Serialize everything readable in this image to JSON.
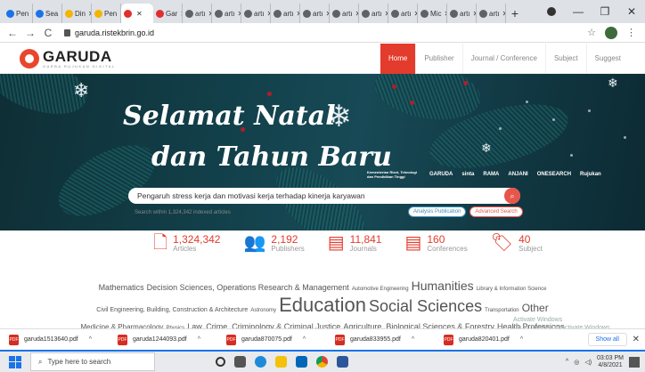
{
  "browser": {
    "tabs": [
      {
        "label": "Pen",
        "icon": "blue"
      },
      {
        "label": "Sea",
        "icon": "blue"
      },
      {
        "label": "Din",
        "icon": "yellow"
      },
      {
        "label": "Pen",
        "icon": "yellow"
      },
      {
        "label": "",
        "icon": "red",
        "active": true
      },
      {
        "label": "Gar",
        "icon": "red"
      },
      {
        "label": "artı",
        "icon": "gray"
      },
      {
        "label": "artı",
        "icon": "gray"
      },
      {
        "label": "artı",
        "icon": "gray"
      },
      {
        "label": "artı",
        "icon": "gray"
      },
      {
        "label": "artı",
        "icon": "gray"
      },
      {
        "label": "artı",
        "icon": "gray"
      },
      {
        "label": "artı",
        "icon": "gray"
      },
      {
        "label": "artı",
        "icon": "gray"
      },
      {
        "label": "Mic",
        "icon": "gray"
      },
      {
        "label": "artı",
        "icon": "gray"
      },
      {
        "label": "artı",
        "icon": "gray"
      }
    ],
    "new_tab": "+",
    "url": "garuda.ristekbrin.go.id",
    "minimize": "—",
    "maximize": "❐",
    "close": "✕"
  },
  "site": {
    "logo_title": "GARUDA",
    "logo_subtitle": "GARBA RUJUKAN DIGITAL",
    "menu": [
      "Home",
      "Publisher",
      "Journal / Conference",
      "Subject",
      "Suggest"
    ]
  },
  "hero": {
    "greeting_line1": "Selamat Natal",
    "greeting_line2": "dan Tahun Baru",
    "sponsors": [
      "Kementerian Riset, Teknologi dan Pendidikan Tinggi",
      "GARUDA",
      "sinta",
      "RAMA",
      "ANJANI",
      "ONESEARCH",
      "Rujukan"
    ],
    "search_value": "Pengaruh stress kerja dan motivasi kerja terhadap kinerja karyawan"
  },
  "search_meta": "Search within 1,324,342 indexed articles",
  "pills": {
    "analysis": "Analysis Publication",
    "advanced": "Advanced Search"
  },
  "stats": [
    {
      "icon": "document-icon",
      "glyph": "🗋",
      "value": "1,324,342",
      "label": "Articles"
    },
    {
      "icon": "publishers-icon",
      "glyph": "👥",
      "value": "2,192",
      "label": "Publishers"
    },
    {
      "icon": "journal-icon",
      "glyph": "▤",
      "value": "11,841",
      "label": "Journals"
    },
    {
      "icon": "conference-icon",
      "glyph": "▤",
      "value": "160",
      "label": "Conferences"
    },
    {
      "icon": "tag-icon",
      "glyph": "🏷",
      "value": "40",
      "label": "Subject"
    }
  ],
  "subjects": [
    {
      "text": "Mathematics",
      "size": 9
    },
    {
      "text": "Decision Sciences, Operations Research & Management",
      "size": 9
    },
    {
      "text": "Automotive Engineering",
      "size": 6
    },
    {
      "text": "Humanities",
      "size": 14
    },
    {
      "text": "Library & Information Science",
      "size": 6
    },
    {
      "text": "Civil Engineering, Building, Construction & Architecture",
      "size": 7
    },
    {
      "text": "Astronomy",
      "size": 6
    },
    {
      "text": "Education",
      "size": 22
    },
    {
      "text": "Social Sciences",
      "size": 18
    },
    {
      "text": "Transportation",
      "size": 6
    },
    {
      "text": "Other",
      "size": 12
    },
    {
      "text": "Medicine & Pharmacology",
      "size": 8
    },
    {
      "text": "Physics",
      "size": 6
    },
    {
      "text": "Law, Crime, Criminology & Criminal Justice",
      "size": 9
    },
    {
      "text": "Agriculture, Biological Sciences & Forestry",
      "size": 9
    },
    {
      "text": "Health Professions",
      "size": 9
    }
  ],
  "windows_activate": {
    "line1": "Activate Windows",
    "line2": "Go to Settings to activate Windows."
  },
  "downloads": [
    "garuda1513640.pdf",
    "garuda1244093.pdf",
    "garuda870075.pdf",
    "garuda833955.pdf",
    "garuda820401.pdf"
  ],
  "show_all": "Show all",
  "taskbar": {
    "search_placeholder": "Type here to search",
    "time": "03:03 PM",
    "date": "4/8/2021"
  }
}
